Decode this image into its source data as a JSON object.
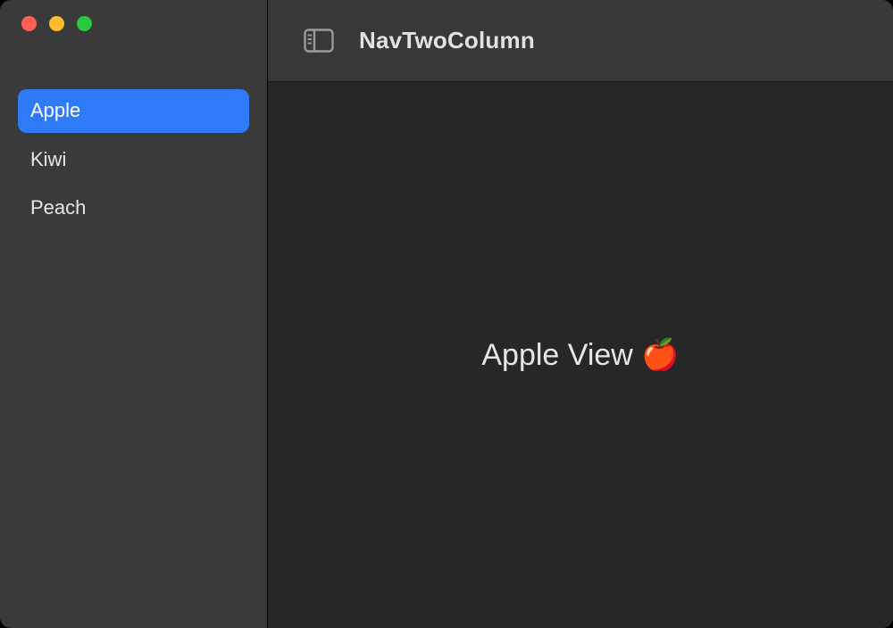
{
  "window": {
    "title": "NavTwoColumn"
  },
  "sidebar": {
    "items": [
      {
        "label": "Apple",
        "selected": true
      },
      {
        "label": "Kiwi",
        "selected": false
      },
      {
        "label": "Peach",
        "selected": false
      }
    ]
  },
  "detail": {
    "text": "Apple View 🍎"
  },
  "icons": {
    "sidebarToggle": "sidebar-toggle-icon"
  },
  "colors": {
    "accent": "#2f7af6",
    "sidebarBg": "#3b3a3b",
    "toolbarBg": "#383838",
    "contentBg": "#272727"
  }
}
